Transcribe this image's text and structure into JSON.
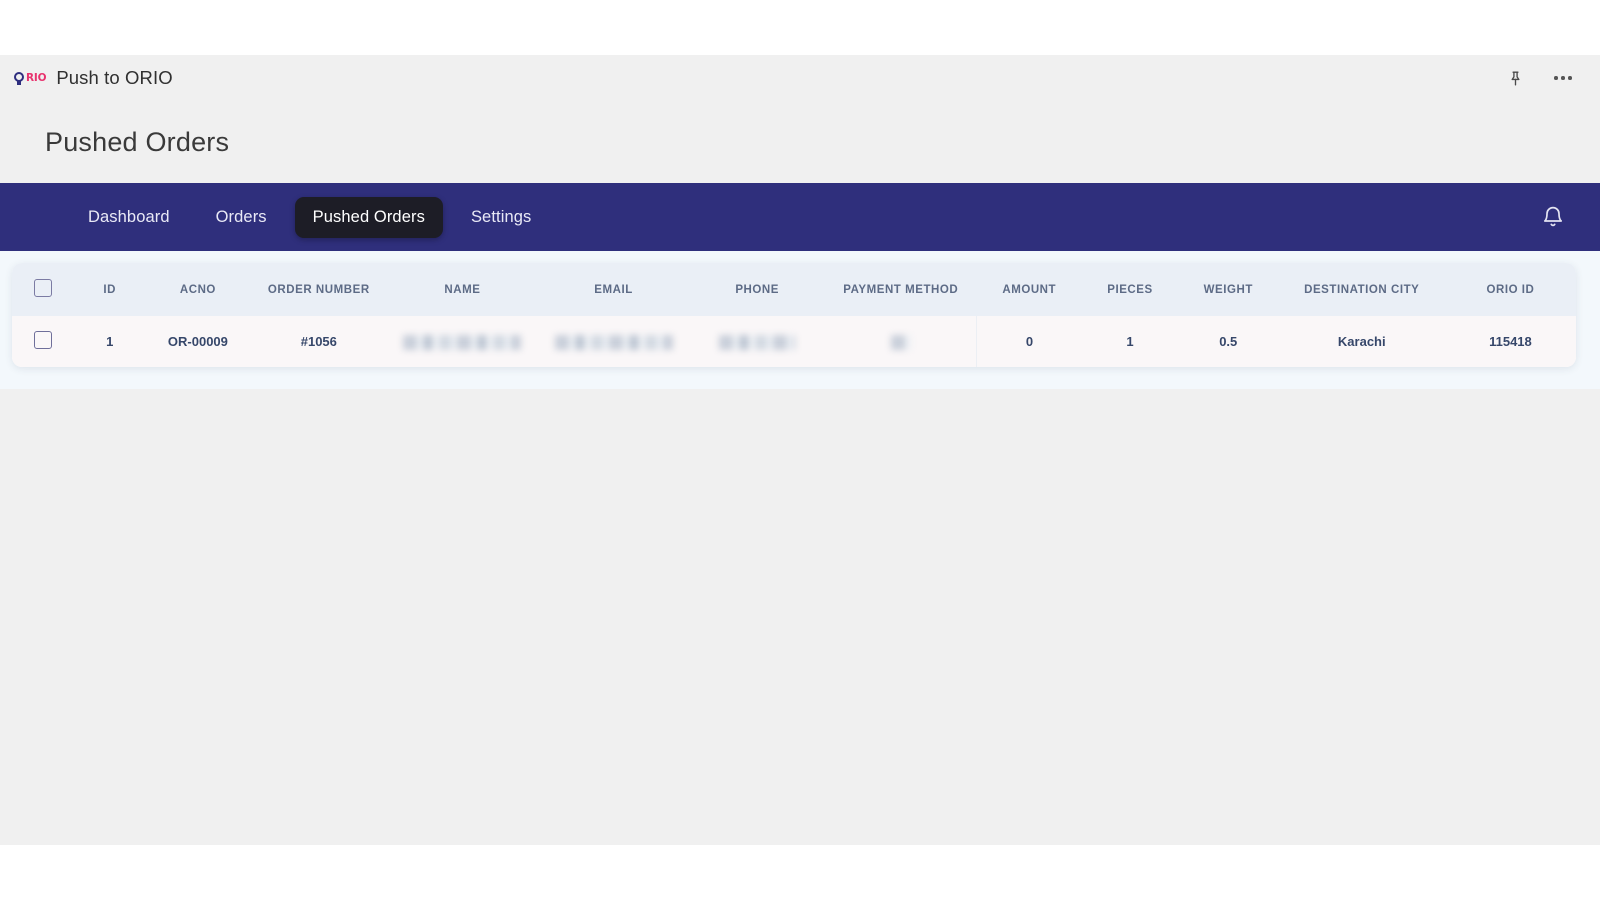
{
  "app": {
    "logo_mark": "orio-logo",
    "logo_wordmark": "RIO",
    "title": "Push to ORIO",
    "titlebar_actions": [
      {
        "name": "pin-icon",
        "label": "Pin"
      },
      {
        "name": "more-options-icon",
        "label": "More options"
      }
    ]
  },
  "page": {
    "heading": "Pushed Orders"
  },
  "nav": {
    "items": [
      {
        "label": "Dashboard",
        "active": false
      },
      {
        "label": "Orders",
        "active": false
      },
      {
        "label": "Pushed Orders",
        "active": true
      },
      {
        "label": "Settings",
        "active": false
      }
    ],
    "notification_icon": "bell-icon",
    "background_color": "#2f2f7c",
    "active_pill_color": "#1d1d26"
  },
  "table": {
    "select_all_checkbox": false,
    "columns": [
      {
        "key": "select",
        "label": ""
      },
      {
        "key": "id",
        "label": "ID"
      },
      {
        "key": "acno",
        "label": "ACNO"
      },
      {
        "key": "order_number",
        "label": "ORDER NUMBER"
      },
      {
        "key": "name",
        "label": "NAME"
      },
      {
        "key": "email",
        "label": "EMAIL"
      },
      {
        "key": "phone",
        "label": "PHONE"
      },
      {
        "key": "payment_method",
        "label": "PAYMENT METHOD"
      },
      {
        "key": "amount",
        "label": "AMOUNT"
      },
      {
        "key": "pieces",
        "label": "PIECES"
      },
      {
        "key": "weight",
        "label": "WEIGHT"
      },
      {
        "key": "destination_city",
        "label": "DESTINATION CITY"
      },
      {
        "key": "orio_id",
        "label": "ORIO ID"
      }
    ],
    "rows": [
      {
        "selected": false,
        "id": "1",
        "acno": "OR-00009",
        "order_number": "#1056",
        "name": "",
        "email": "",
        "phone": "",
        "payment_method": "",
        "amount": "0",
        "pieces": "1",
        "weight": "0.5",
        "destination_city": "Karachi",
        "orio_id": "115418"
      }
    ],
    "redacted_fields": [
      "name",
      "email",
      "phone",
      "payment_method"
    ],
    "header_background": "#eaeff6",
    "row_background": "#faf7f8",
    "text_color": "#36476a"
  }
}
